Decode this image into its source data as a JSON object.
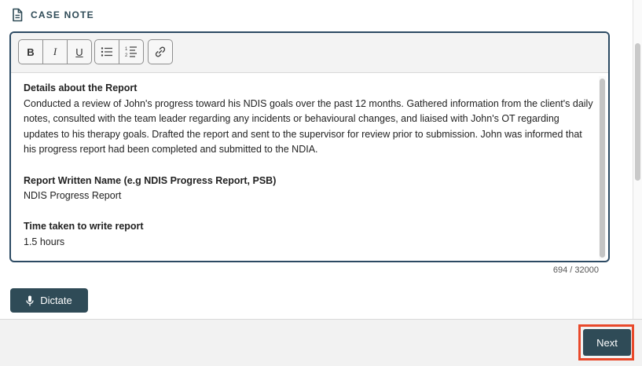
{
  "section": {
    "title": "CASE NOTE",
    "icon": "document-icon"
  },
  "toolbar": {
    "bold": "B",
    "italic": "I",
    "underline": "U"
  },
  "note": {
    "heading1": "Details about the Report",
    "paragraph1": "Conducted a review of John's progress toward his NDIS goals over the past 12 months. Gathered information from the client's daily notes, consulted with the team leader regarding any incidents or behavioural changes, and liaised with John's OT regarding updates to his therapy goals. Drafted the report and sent to the supervisor for review prior to submission. John was informed that his progress report had been completed and submitted to the NDIA.",
    "heading2": "Report Written Name (e.g NDIS Progress Report, PSB)",
    "value2": "NDIS Progress Report",
    "heading3": "Time taken to write report",
    "value3": "1.5 hours"
  },
  "char_count": "694 / 32000",
  "dictate_label": "Dictate",
  "next_label": "Next",
  "colors": {
    "accent": "#2f4b57",
    "border": "#2c4a63",
    "highlight": "#e9492b"
  }
}
